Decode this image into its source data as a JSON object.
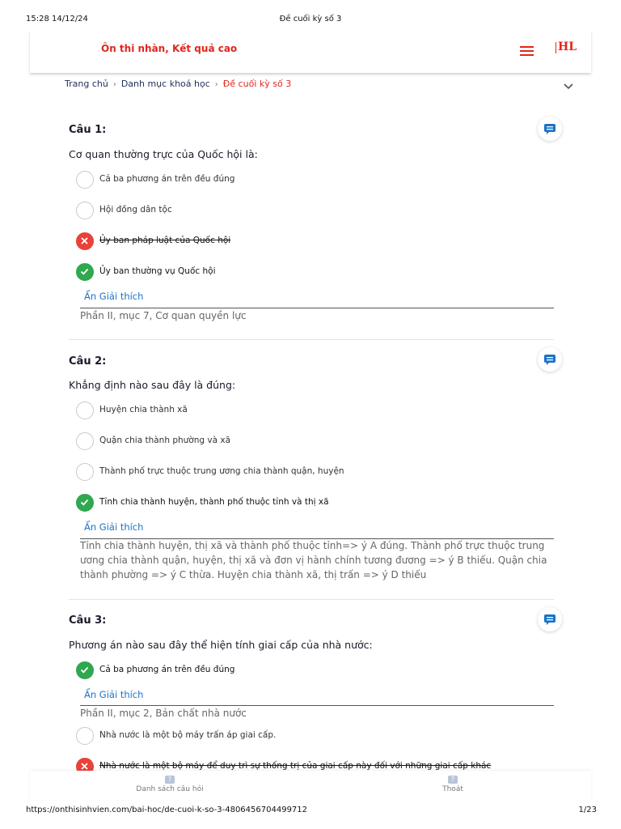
{
  "print": {
    "datetime": "15:28 14/12/24",
    "doc_title": "Đề cuối kỳ số 3",
    "url": "https://onthisinhvien.com/bai-hoc/de-cuoi-k-so-3-4806456704499712",
    "page": "1/23"
  },
  "header": {
    "brand": "Ôn thi nhàn, Kết quả cao",
    "logo_text": "HL"
  },
  "breadcrumb": {
    "home": "Trang chủ",
    "category": "Danh mục khoá học",
    "current": "Đề cuối kỳ số 3"
  },
  "colors": {
    "brand_red": "#e1261c",
    "correct_green": "#2fa84f",
    "wrong_red": "#e8423a",
    "link_blue": "#1a73c8",
    "comment_blue": "#1a73c8"
  },
  "questions": [
    {
      "title": "Câu 1:",
      "text": "Cơ quan thường trực của Quốc hội là:",
      "options": [
        {
          "label": "Cả ba phương án trên đều đúng",
          "state": "none"
        },
        {
          "label": "Hội đồng dân tộc",
          "state": "none"
        },
        {
          "label": "Ủy ban pháp luật của Quốc hội",
          "state": "wrong"
        },
        {
          "label": "Ủy ban thường vụ Quốc hội",
          "state": "correct"
        }
      ],
      "explain_link": "Ẩn Giải thích",
      "explanation": "Phần II, mục 7, Cơ quan quyền lực"
    },
    {
      "title": "Câu 2:",
      "text": "Khẳng định nào sau đây là đúng:",
      "options": [
        {
          "label": "Huyện chia thành xã",
          "state": "none"
        },
        {
          "label": "Quận chia thành phường và xã",
          "state": "none"
        },
        {
          "label": "Thành phố trực thuộc trung ương chia thành quận, huyện",
          "state": "none"
        },
        {
          "label": "Tỉnh chia thành huyện, thành phố thuộc tỉnh và thị xã",
          "state": "correct"
        }
      ],
      "explain_link": "Ẩn Giải thích",
      "explanation": "Tỉnh chia thành huyện, thị xã và thành phố thuộc tỉnh=> ý A đúng. Thành phố trực thuộc trung ương chia thành quận, huyện, thị xã và đơn vị hành chính tương đương => ý B thiếu. Quận chia thành phường => ý C thừa. Huyện chia thành xã, thị trấn => ý D thiếu"
    },
    {
      "title": "Câu 3:",
      "text": "Phương án nào sau đây thể hiện tính giai cấp của nhà nước:",
      "options": [
        {
          "label": "Cả ba phương án trên đều đúng",
          "state": "correct"
        },
        {
          "label": "Nhà nước là một bộ máy trấn áp giai cấp.",
          "state": "none"
        },
        {
          "label": "Nhà nước là một bộ máy để duy trì sự thống trị của giai cấp này đối với những giai cấp khác",
          "state": "wrong"
        }
      ],
      "explain_link": "Ẩn Giải thích",
      "explanation": "Phần II, mục 2, Bản chất nhà nước"
    }
  ],
  "bottom_bar": {
    "list_label": "Danh sách câu hỏi",
    "exit_label": "Thoát",
    "icon_glyph": "?"
  },
  "icons": {
    "menu": "hamburger-menu-icon",
    "expand": "chevron-down-icon",
    "comment": "comment-icon",
    "check": "check-icon",
    "cross": "close-icon"
  }
}
